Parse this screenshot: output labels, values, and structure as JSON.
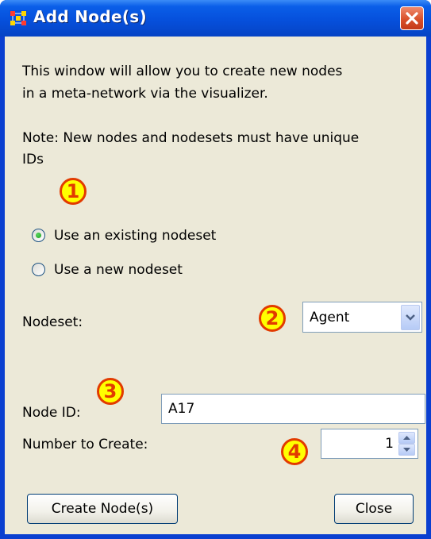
{
  "window": {
    "title": "Add Node(s)",
    "close_icon": "close-x-icon",
    "app_icon": "network-nodes-icon"
  },
  "description": {
    "line1": "This window will allow you to create new nodes",
    "line2": "in a meta-network via the visualizer."
  },
  "note": {
    "line1": "Note: New nodes and nodesets must have unique",
    "line2": "IDs"
  },
  "callouts": [
    "1",
    "2",
    "3",
    "4"
  ],
  "options": [
    {
      "label": "Use an existing nodeset",
      "selected": true
    },
    {
      "label": "Use a new nodeset",
      "selected": false
    }
  ],
  "nodeset": {
    "label": "Nodeset:",
    "selected_value": "Agent"
  },
  "node_id": {
    "label": "Node ID:",
    "value": "A17"
  },
  "number_to_create": {
    "label": "Number to Create:",
    "value": "1"
  },
  "buttons": {
    "create_label": "Create Node(s)",
    "close_label": "Close"
  },
  "colors": {
    "title_bar": "#0a5ee8",
    "dialog_bg": "#ece9d8",
    "callout_fill": "#ffff00",
    "callout_border": "#e23b00"
  }
}
